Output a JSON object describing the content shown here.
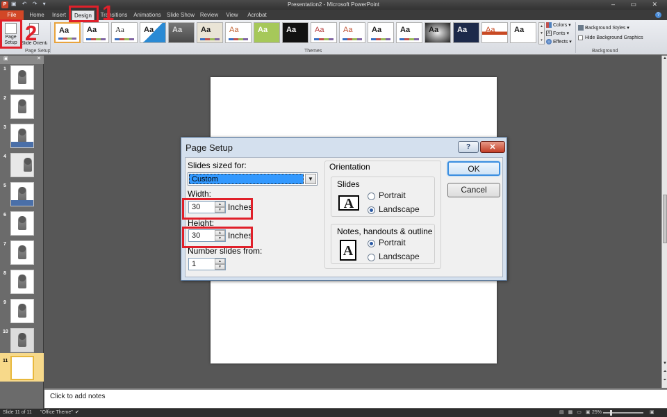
{
  "window": {
    "title": "Presentation2 - Microsoft PowerPoint",
    "app_icon": "P",
    "quick_access": "▣ ↶ ↷ ▾",
    "controls": "– ▭ ✕"
  },
  "tabs": [
    {
      "label": "File"
    },
    {
      "label": "Home"
    },
    {
      "label": "Insert"
    },
    {
      "label": "Design"
    },
    {
      "label": "Transitions"
    },
    {
      "label": "Animations"
    },
    {
      "label": "Slide Show"
    },
    {
      "label": "Review"
    },
    {
      "label": "View"
    },
    {
      "label": "Acrobat"
    }
  ],
  "ribbon": {
    "page_setup_label": "Page Setup",
    "orientation_label": "Slide Orientation",
    "group_page_setup": "Page Setup",
    "group_themes": "Themes",
    "group_background": "Background",
    "theme_sample": "Aa",
    "colors": "Colors ▾",
    "fonts": "Fonts ▾",
    "effects": "Effects ▾",
    "background_styles": "Background Styles ▾",
    "hide_background": "Hide Background Graphics"
  },
  "annotations": {
    "step1": "1",
    "step2": "2"
  },
  "slide_panel": {
    "thumbnails": [
      "1",
      "2",
      "3",
      "4",
      "5",
      "6",
      "7",
      "8",
      "9",
      "10",
      "11"
    ],
    "active": "11"
  },
  "notes": {
    "placeholder": "Click to add notes"
  },
  "status_bar": {
    "slide_info": "Slide 11 of 11",
    "theme": "\"Office Theme\"",
    "zoom": "25%"
  },
  "dialog": {
    "title": "Page Setup",
    "help": "?",
    "close": "✕",
    "slides_sized_for_label": "Slides sized for:",
    "slides_sized_for_value": "Custom",
    "width_label": "Width:",
    "width_value": "30",
    "width_unit": "Inches",
    "height_label": "Height:",
    "height_value": "30",
    "height_unit": "Inches",
    "number_from_label": "Number slides from:",
    "number_from_value": "1",
    "orientation_label": "Orientation",
    "slides_label": "Slides",
    "slides_portrait": "Portrait",
    "slides_landscape": "Landscape",
    "slides_selected": "Landscape",
    "notes_label": "Notes, handouts & outline",
    "notes_portrait": "Portrait",
    "notes_landscape": "Landscape",
    "notes_selected": "Portrait",
    "ok": "OK",
    "cancel": "Cancel",
    "icon_letter": "A"
  }
}
